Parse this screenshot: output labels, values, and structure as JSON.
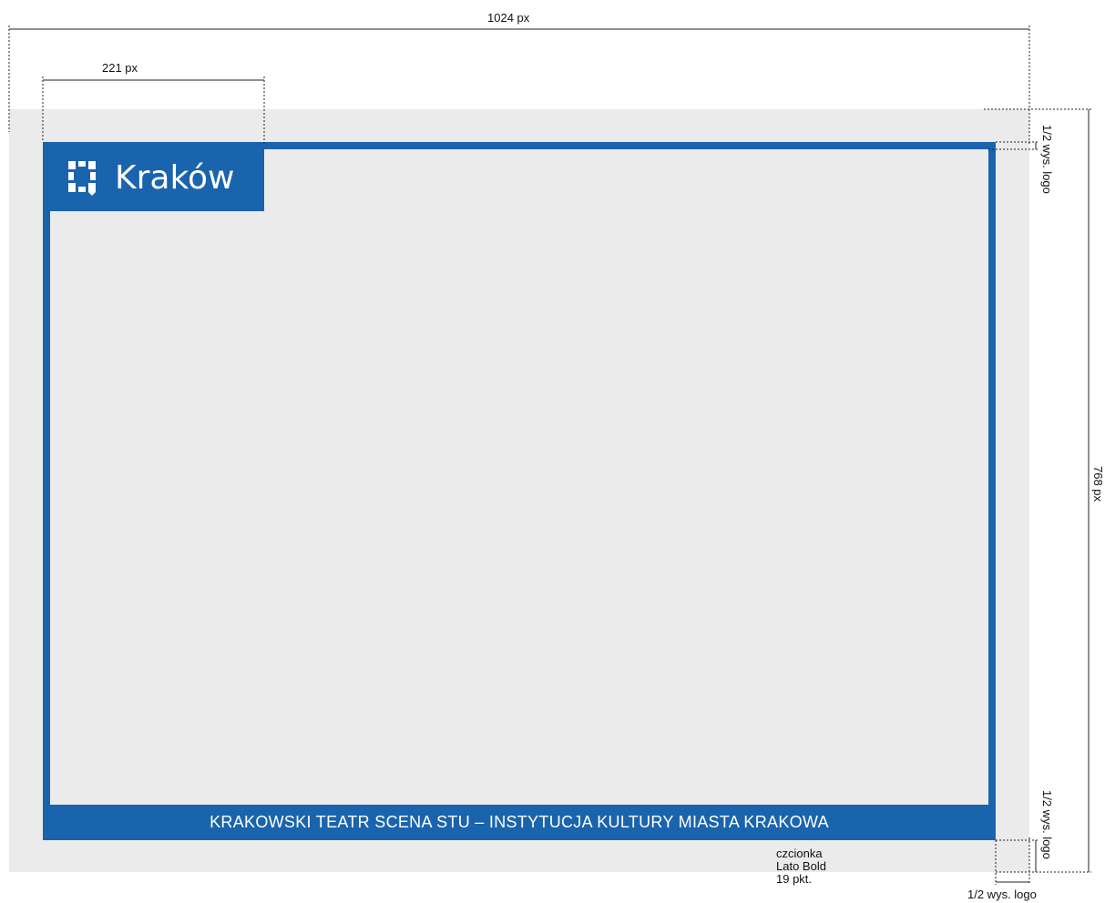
{
  "dimensions": {
    "width_label": "1024 px",
    "logo_width_label": "221 px",
    "height_label": "768 px",
    "half_logo_top_label": "1/2 wys. logo",
    "half_logo_bottom_label": "1/2 wys. logo",
    "half_logo_right_label": "1/2 wys. logo"
  },
  "logo": {
    "text": "Kraków",
    "icon": "krakow-mark-icon"
  },
  "footer": {
    "text": "KRAKOWSKI TEATR  SCENA STU  – INSTYTUCJA  KULTURY  MIASTA  KRAKOWA"
  },
  "font_note": {
    "line1": "czcionka",
    "line2": "Lato Bold",
    "line3": "19 pkt."
  },
  "colors": {
    "brand_blue": "#1a64ad",
    "canvas_gray": "#ebebeb"
  }
}
